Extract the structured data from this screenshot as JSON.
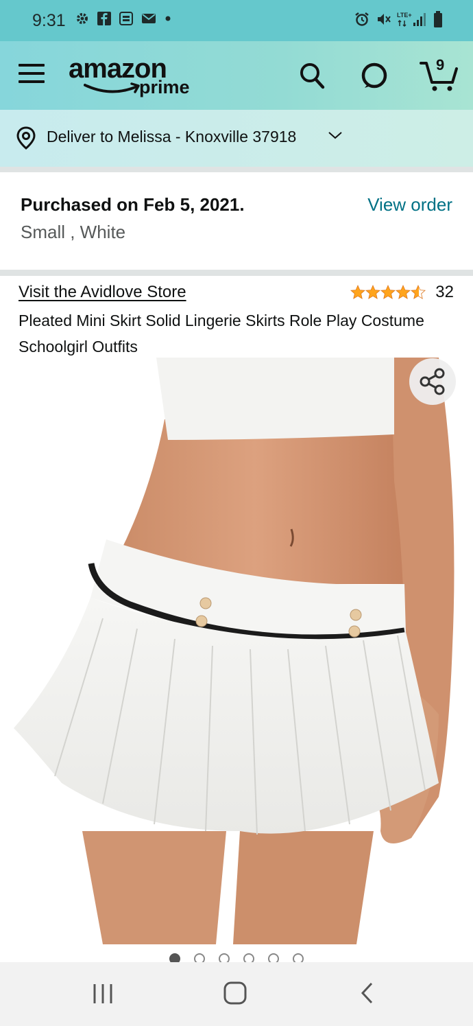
{
  "status_bar": {
    "time": "9:31",
    "left_icons": [
      "gear-icon",
      "facebook-icon",
      "pch-icon",
      "mail-icon",
      "dot-icon"
    ],
    "right_icons": [
      "alarm-icon",
      "mute-icon",
      "lte-signal-icon",
      "battery-icon"
    ],
    "network_label": "LTE+"
  },
  "header": {
    "logo_word": "amazon",
    "logo_sub": "prime",
    "cart_count": "9"
  },
  "deliver": {
    "text": "Deliver to Melissa - Knoxville 37918"
  },
  "purchase": {
    "date_text": "Purchased on Feb 5, 2021.",
    "variant_text": "Small , White",
    "view_order_label": "View order"
  },
  "product": {
    "store_link": "Visit the Avidlove Store",
    "rating_value": 4.5,
    "rating_count": "32",
    "title": "Pleated Mini Skirt Solid Lingerie Skirts Role Play Costume Schoolgirl Outfits",
    "image_count": 6,
    "active_image_index": 0
  },
  "colors": {
    "status_bar": "#65c8cc",
    "header": "#8fd8d6",
    "link": "#007185",
    "star": "#ffa41c"
  }
}
